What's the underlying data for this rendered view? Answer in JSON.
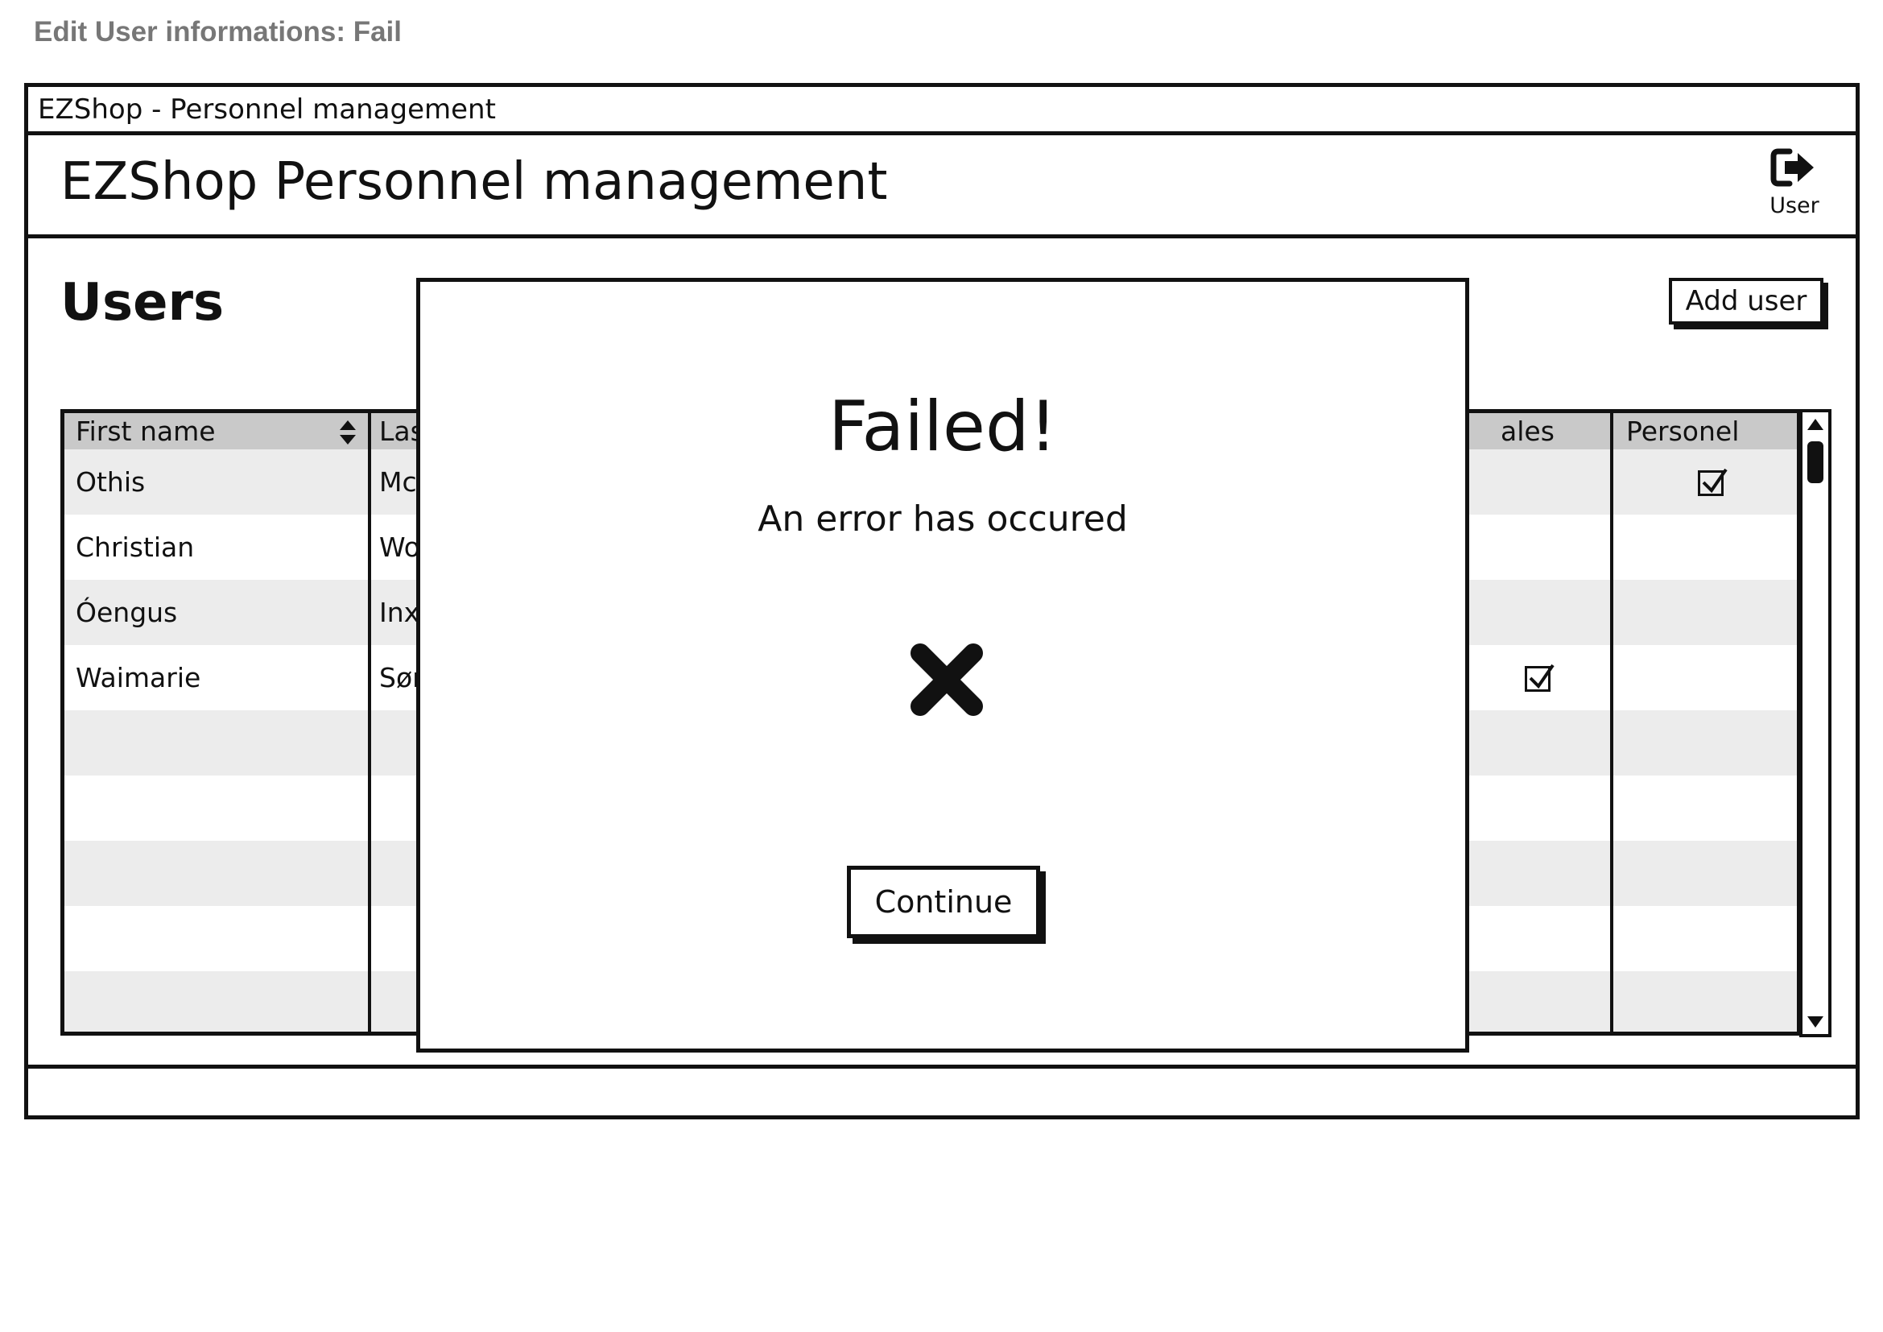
{
  "page_caption": "Edit User informations: Fail",
  "window": {
    "title": "EZShop - Personnel management",
    "app_title": "EZShop Personnel management",
    "user_menu": {
      "label": "User",
      "icon": "logout-icon"
    }
  },
  "users": {
    "section_title": "Users",
    "add_button": "Add user",
    "columns": [
      "First name",
      "Las",
      "ales",
      "Personel"
    ],
    "rows": [
      {
        "first_name": "Othis",
        "last_name": "McS",
        "sales": false,
        "personel": true
      },
      {
        "first_name": "Christian",
        "last_name": "Wol",
        "sales": false,
        "personel": false
      },
      {
        "first_name": "Óengus",
        "last_name": "Inx",
        "sales": false,
        "personel": false
      },
      {
        "first_name": "Waimarie",
        "last_name": "Sør",
        "sales": true,
        "personel": false
      }
    ]
  },
  "modal": {
    "title": "Failed!",
    "message": "An error has occured",
    "icon": "error-x-icon",
    "button": "Continue"
  }
}
